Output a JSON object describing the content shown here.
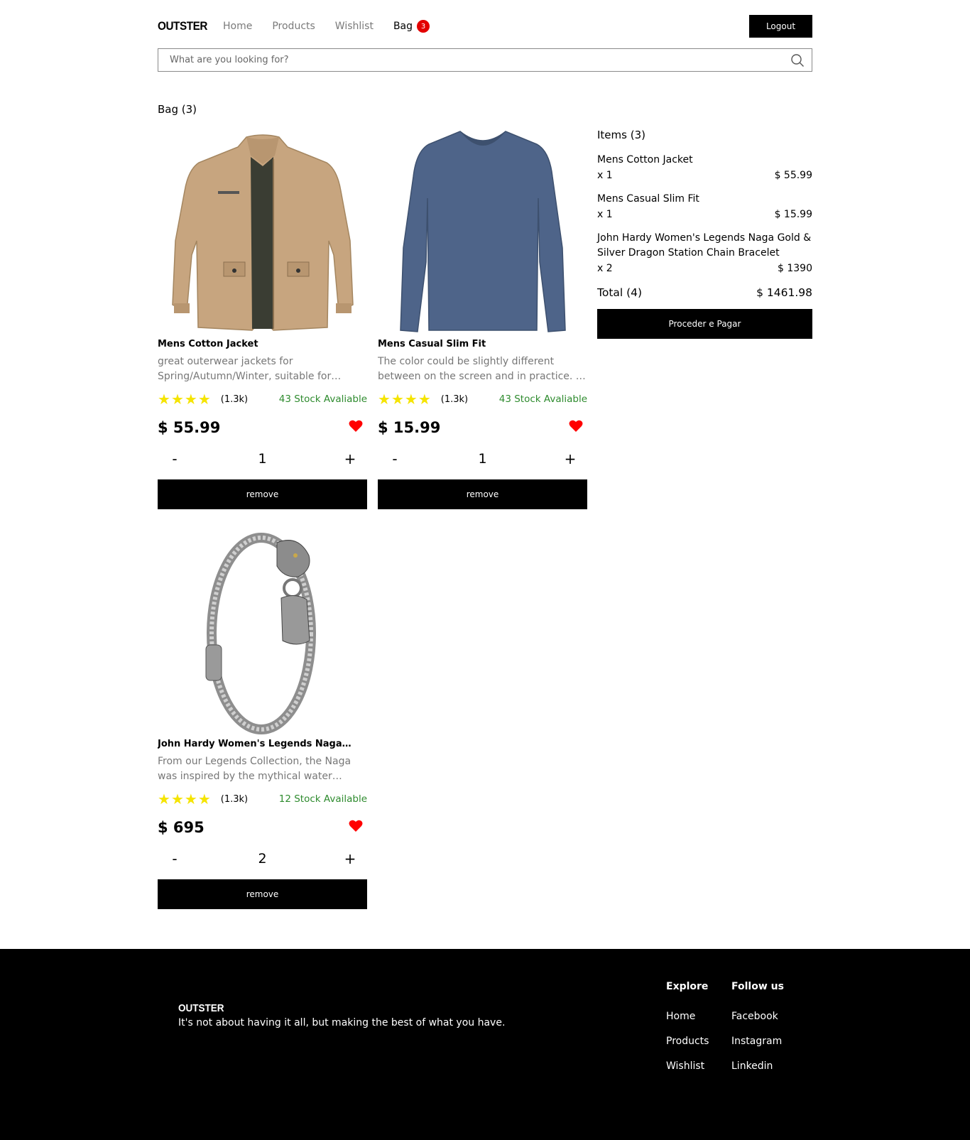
{
  "header": {
    "logo": "OUTSTER",
    "nav": [
      "Home",
      "Products",
      "Wishlist"
    ],
    "bag_label": "Bag",
    "bag_count": "3",
    "logout_label": "Logout"
  },
  "search": {
    "placeholder": "What are you looking for?"
  },
  "page_title": "Bag (3)",
  "products": [
    {
      "name": "Mens Cotton Jacket",
      "desc": "great outerwear jackets for Spring/Autumn/Winter, suitable for…",
      "reviews": "(1.3k)",
      "stars": 4,
      "stock": "43 Stock Avaliable",
      "price": "$ 55.99",
      "qty": "1",
      "minus": "-",
      "plus": "+",
      "remove": "remove"
    },
    {
      "name": "Mens Casual Slim Fit",
      "desc": "The color could be slightly different between on the screen and in practice. …",
      "reviews": "(1.3k)",
      "stars": 4,
      "stock": "43 Stock Avaliable",
      "price": "$ 15.99",
      "qty": "1",
      "minus": "-",
      "plus": "+",
      "remove": "remove"
    },
    {
      "name": "John Hardy Women's Legends Naga…",
      "desc": "From our Legends Collection, the Naga was inspired by the mythical water…",
      "reviews": "(1.3k)",
      "stars": 4,
      "stock": "12 Stock Available",
      "price": "$ 695",
      "qty": "2",
      "minus": "-",
      "plus": "+",
      "remove": "remove"
    }
  ],
  "summary": {
    "title": "Items (3)",
    "items": [
      {
        "name": "Mens Cotton Jacket",
        "qty": "x 1",
        "price": "$ 55.99"
      },
      {
        "name": "Mens Casual Slim Fit",
        "qty": "x 1",
        "price": "$ 15.99"
      },
      {
        "name": "John Hardy Women's Legends Naga Gold & Silver Dragon Station Chain Bracelet",
        "qty": "x 2",
        "price": "$ 1390"
      }
    ],
    "total_label": "Total (4)",
    "total_value": "$ 1461.98",
    "proceed_label": "Proceder e Pagar"
  },
  "footer": {
    "logo": "OUTSTER",
    "tagline": "It's not about having it all, but making the best of what you have.",
    "explore_title": "Explore",
    "explore_links": [
      "Home",
      "Products",
      "Wishlist"
    ],
    "follow_title": "Follow us",
    "follow_links": [
      "Facebook",
      "Instagram",
      "Linkedin"
    ]
  },
  "colors": {
    "accent": "#000000",
    "badge": "#e30000",
    "star": "#f5e400",
    "stock": "#2e8b2e",
    "heart": "#ff0000"
  }
}
